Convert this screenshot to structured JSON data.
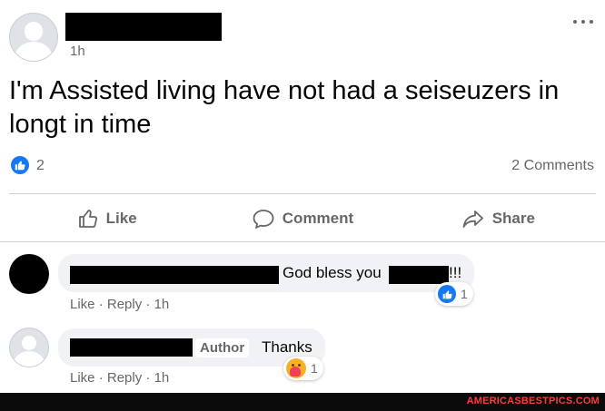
{
  "post": {
    "time": "1h",
    "text": "I'm Assisted living have not had a seiseuzers in longt in time",
    "reaction_count": "2",
    "comment_count": "2 Comments"
  },
  "actions": {
    "like": "Like",
    "comment": "Comment",
    "share": "Share"
  },
  "comments": [
    {
      "text": "God bless you",
      "suffix": "!!!",
      "like_label": "Like",
      "reply_label": "Reply",
      "time": "1h",
      "reaction_count": "1"
    },
    {
      "author_badge": "Author",
      "text": "Thanks",
      "like_label": "Like",
      "reply_label": "Reply",
      "time": "1h",
      "reaction_count": "1"
    }
  ],
  "meta_separator": "·",
  "watermark": "AMERICASBESTPICS.COM",
  "colors": {
    "accent_blue": "#1877f2",
    "secondary_text": "#65676b",
    "bubble_bg": "#f0f2f5",
    "watermark_red": "#ff3a3a"
  },
  "icons": [
    "avatar-placeholder",
    "more-options-icon",
    "like-thumb-icon",
    "comment-icon",
    "share-arrow-icon",
    "care-reaction-icon"
  ]
}
